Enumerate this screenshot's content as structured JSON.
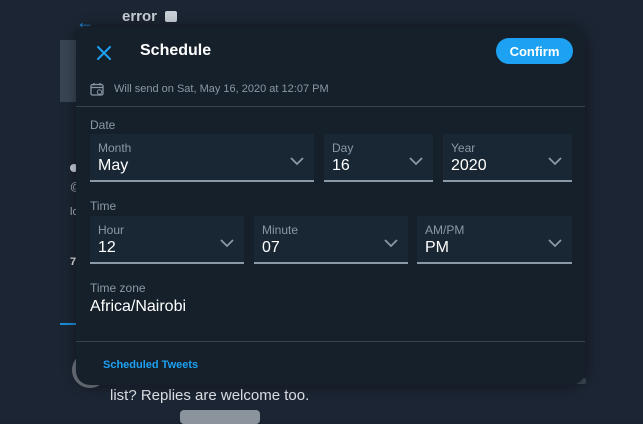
{
  "background": {
    "profile_title": "error",
    "fragment_a": "@",
    "fragment_b": "lo",
    "fragment_c": "7",
    "tweet_text": "list? Replies are welcome too."
  },
  "modal": {
    "title": "Schedule",
    "confirm_label": "Confirm",
    "send_info": "Will send on Sat, May 16, 2020 at 12:07 PM",
    "date_section_label": "Date",
    "time_section_label": "Time",
    "fields": {
      "month": {
        "label": "Month",
        "value": "May"
      },
      "day": {
        "label": "Day",
        "value": "16"
      },
      "year": {
        "label": "Year",
        "value": "2020"
      },
      "hour": {
        "label": "Hour",
        "value": "12"
      },
      "minute": {
        "label": "Minute",
        "value": "07"
      },
      "ampm": {
        "label": "AM/PM",
        "value": "PM"
      }
    },
    "timezone_label": "Time zone",
    "timezone_value": "Africa/Nairobi",
    "scheduled_tweets_link": "Scheduled Tweets"
  },
  "colors": {
    "accent": "#1da1f2",
    "modal_bg": "#15202b",
    "field_bg": "#192734",
    "muted_text": "#8b98a5"
  },
  "icons": {
    "close": "close-icon",
    "calendar": "calendar-icon",
    "chevron": "chevron-down-icon",
    "back": "back-arrow-icon",
    "lock": "lock-icon"
  }
}
